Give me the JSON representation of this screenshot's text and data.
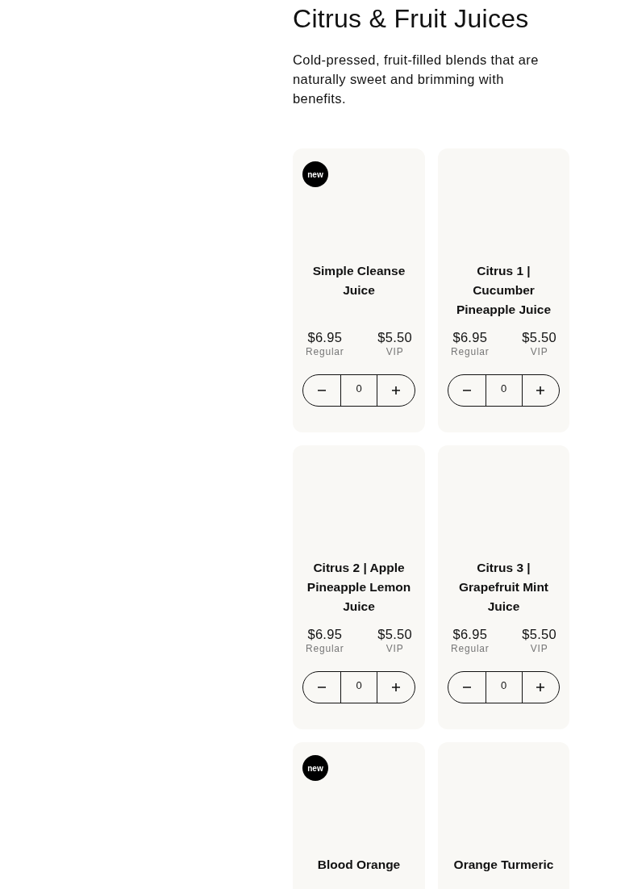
{
  "heading": "Citrus & Fruit Juices",
  "description": "Cold-pressed, fruit-filled blends that are naturally sweet and brimming with benefits.",
  "products": [
    {
      "name": "Simple Cleanse Juice",
      "badge": "new",
      "regular_price": "$6.95",
      "regular_label": "Regular",
      "vip_price": "$5.50",
      "vip_label": "VIP",
      "quantity": "0"
    },
    {
      "name": "Citrus 1 | Cucumber Pineapple Juice",
      "regular_price": "$6.95",
      "regular_label": "Regular",
      "vip_price": "$5.50",
      "vip_label": "VIP",
      "quantity": "0"
    },
    {
      "name": "Citrus 2 | Apple Pineapple Lemon Juice",
      "regular_price": "$6.95",
      "regular_label": "Regular",
      "vip_price": "$5.50",
      "vip_label": "VIP",
      "quantity": "0"
    },
    {
      "name": "Citrus 3 | Grapefruit Mint Juice",
      "regular_price": "$6.95",
      "regular_label": "Regular",
      "vip_price": "$5.50",
      "vip_label": "VIP",
      "quantity": "0"
    },
    {
      "name": "Blood Orange",
      "badge": "new"
    },
    {
      "name": "Orange Turmeric"
    }
  ]
}
